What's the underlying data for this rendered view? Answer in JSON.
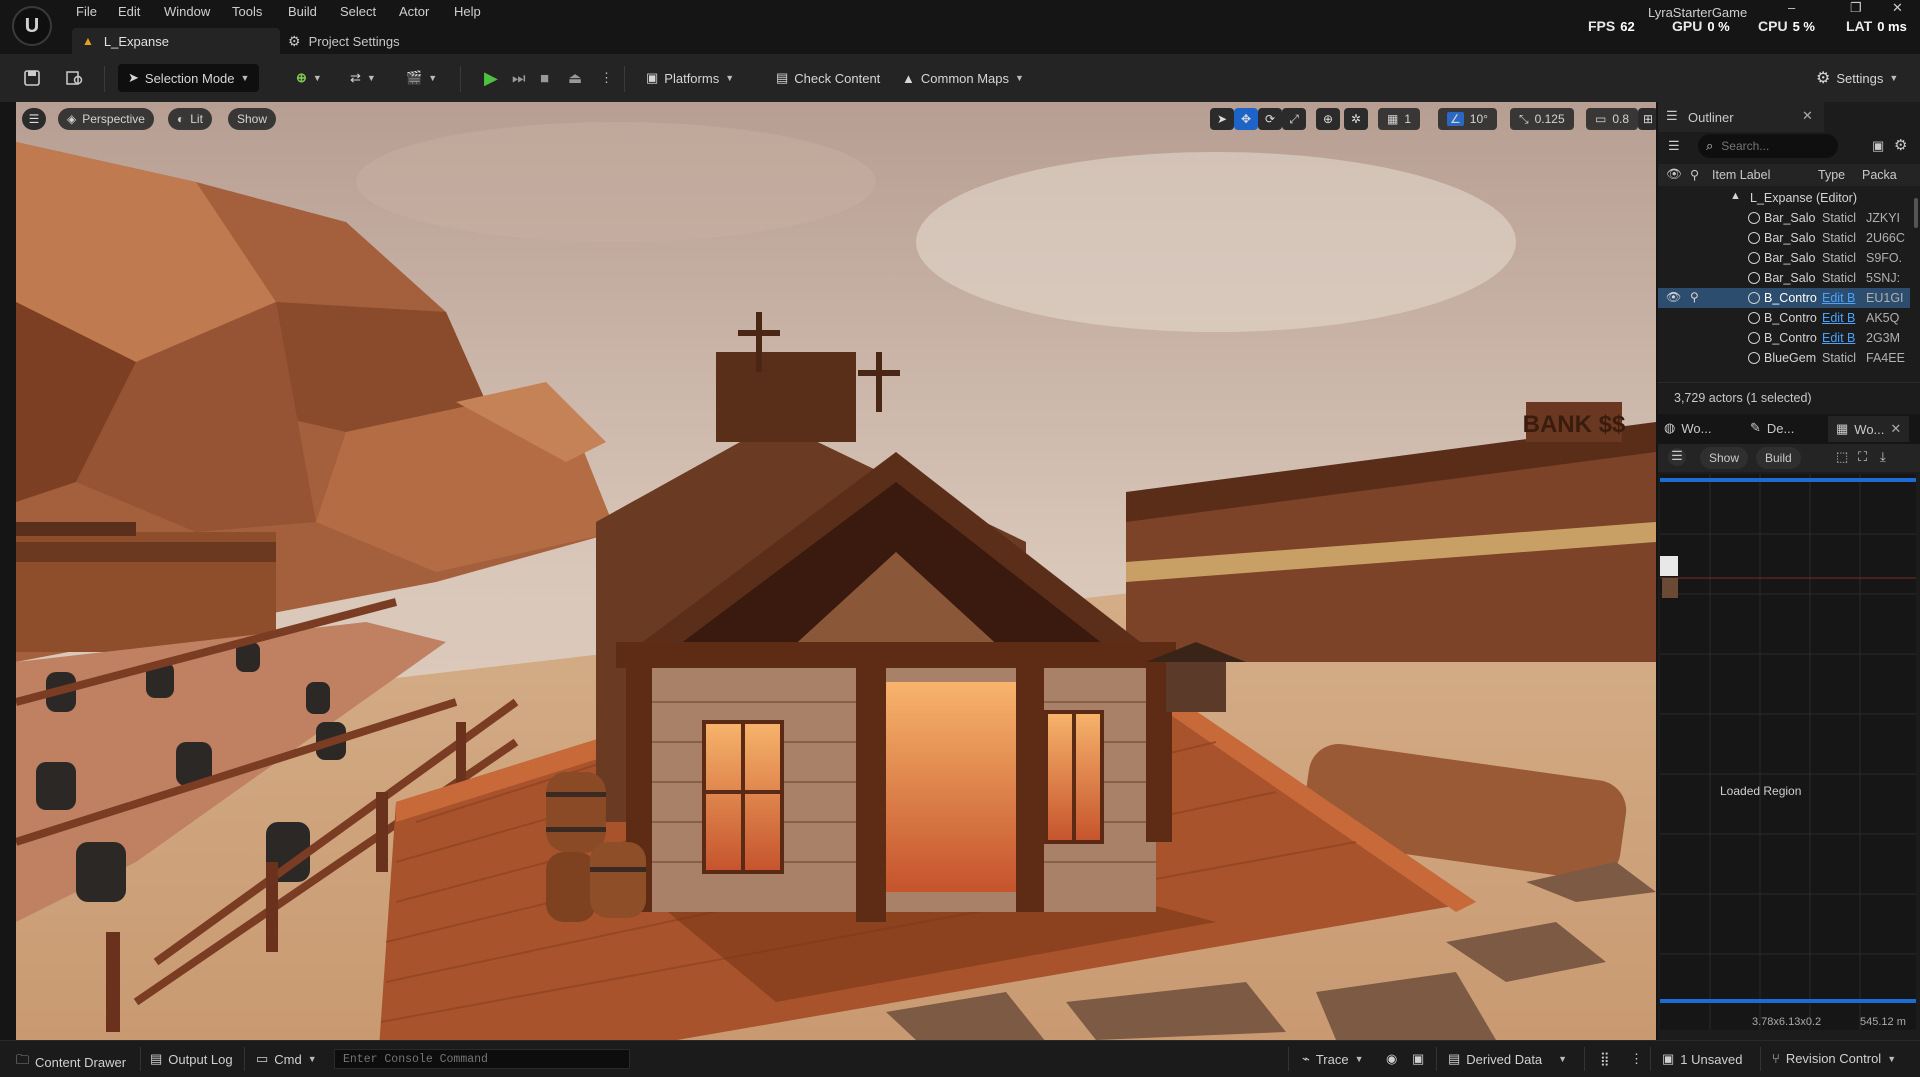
{
  "menu": [
    "File",
    "Edit",
    "Window",
    "Tools",
    "Build",
    "Select",
    "Actor",
    "Help"
  ],
  "tabs": {
    "level": "L_Expanse",
    "project_settings": "Project Settings"
  },
  "project": "LyraStarterGame",
  "stats": {
    "fps_label": "FPS",
    "fps": "62",
    "gpu_label": "GPU",
    "gpu": "0 %",
    "cpu_label": "CPU",
    "cpu": "5 %",
    "lat_label": "LAT",
    "lat": "0 ms"
  },
  "window_controls": {
    "minimize": "–",
    "restore": "❐",
    "close": "✕"
  },
  "toolbar": {
    "selection_mode": "Selection Mode",
    "platforms": "Platforms",
    "check_content": "Check Content",
    "common_maps": "Common Maps",
    "settings": "Settings"
  },
  "viewport": {
    "perspective": "Perspective",
    "lit": "Lit",
    "show": "Show",
    "grid_snap": "1",
    "rot_snap": "10°",
    "scale_snap": "0.125",
    "cam_speed": "0.8",
    "bank_sign": "BANK $$"
  },
  "outliner": {
    "title": "Outliner",
    "search_placeholder": "Search...",
    "col_label": "Item Label",
    "col_type": "Type",
    "col_pkg": "Packa",
    "root": "L_Expanse (Editor)",
    "rows": [
      {
        "label": "Bar_Salo",
        "type": "Staticl",
        "pkg": "JZKYI"
      },
      {
        "label": "Bar_Salo",
        "type": "Staticl",
        "pkg": "2U66C"
      },
      {
        "label": "Bar_Salo",
        "type": "Staticl",
        "pkg": "S9FO."
      },
      {
        "label": "Bar_Salo",
        "type": "Staticl",
        "pkg": "5SNJ:"
      },
      {
        "label": "B_Contro",
        "type": "Edit B",
        "pkg": "EU1GI"
      },
      {
        "label": "B_Contro",
        "type": "Edit B",
        "pkg": "AK5Q"
      },
      {
        "label": "B_Contro",
        "type": "Edit B",
        "pkg": "2G3M"
      },
      {
        "label": "BlueGem",
        "type": "Staticl",
        "pkg": "FA4EE"
      }
    ],
    "footer": "3,729 actors (1 selected)"
  },
  "worldpart": {
    "tabs": [
      "Wo...",
      "De...",
      "Wo..."
    ],
    "show": "Show",
    "build": "Build",
    "loaded_region": "Loaded Region",
    "coords": "3.78x6.13x0.2",
    "distance": "545.12 m"
  },
  "statusbar": {
    "content_drawer": "Content Drawer",
    "output_log": "Output Log",
    "cmd": "Cmd",
    "console_placeholder": "Enter Console Command",
    "trace": "Trace",
    "derived_data": "Derived Data",
    "unsaved": "1 Unsaved",
    "revision_control": "Revision Control"
  }
}
